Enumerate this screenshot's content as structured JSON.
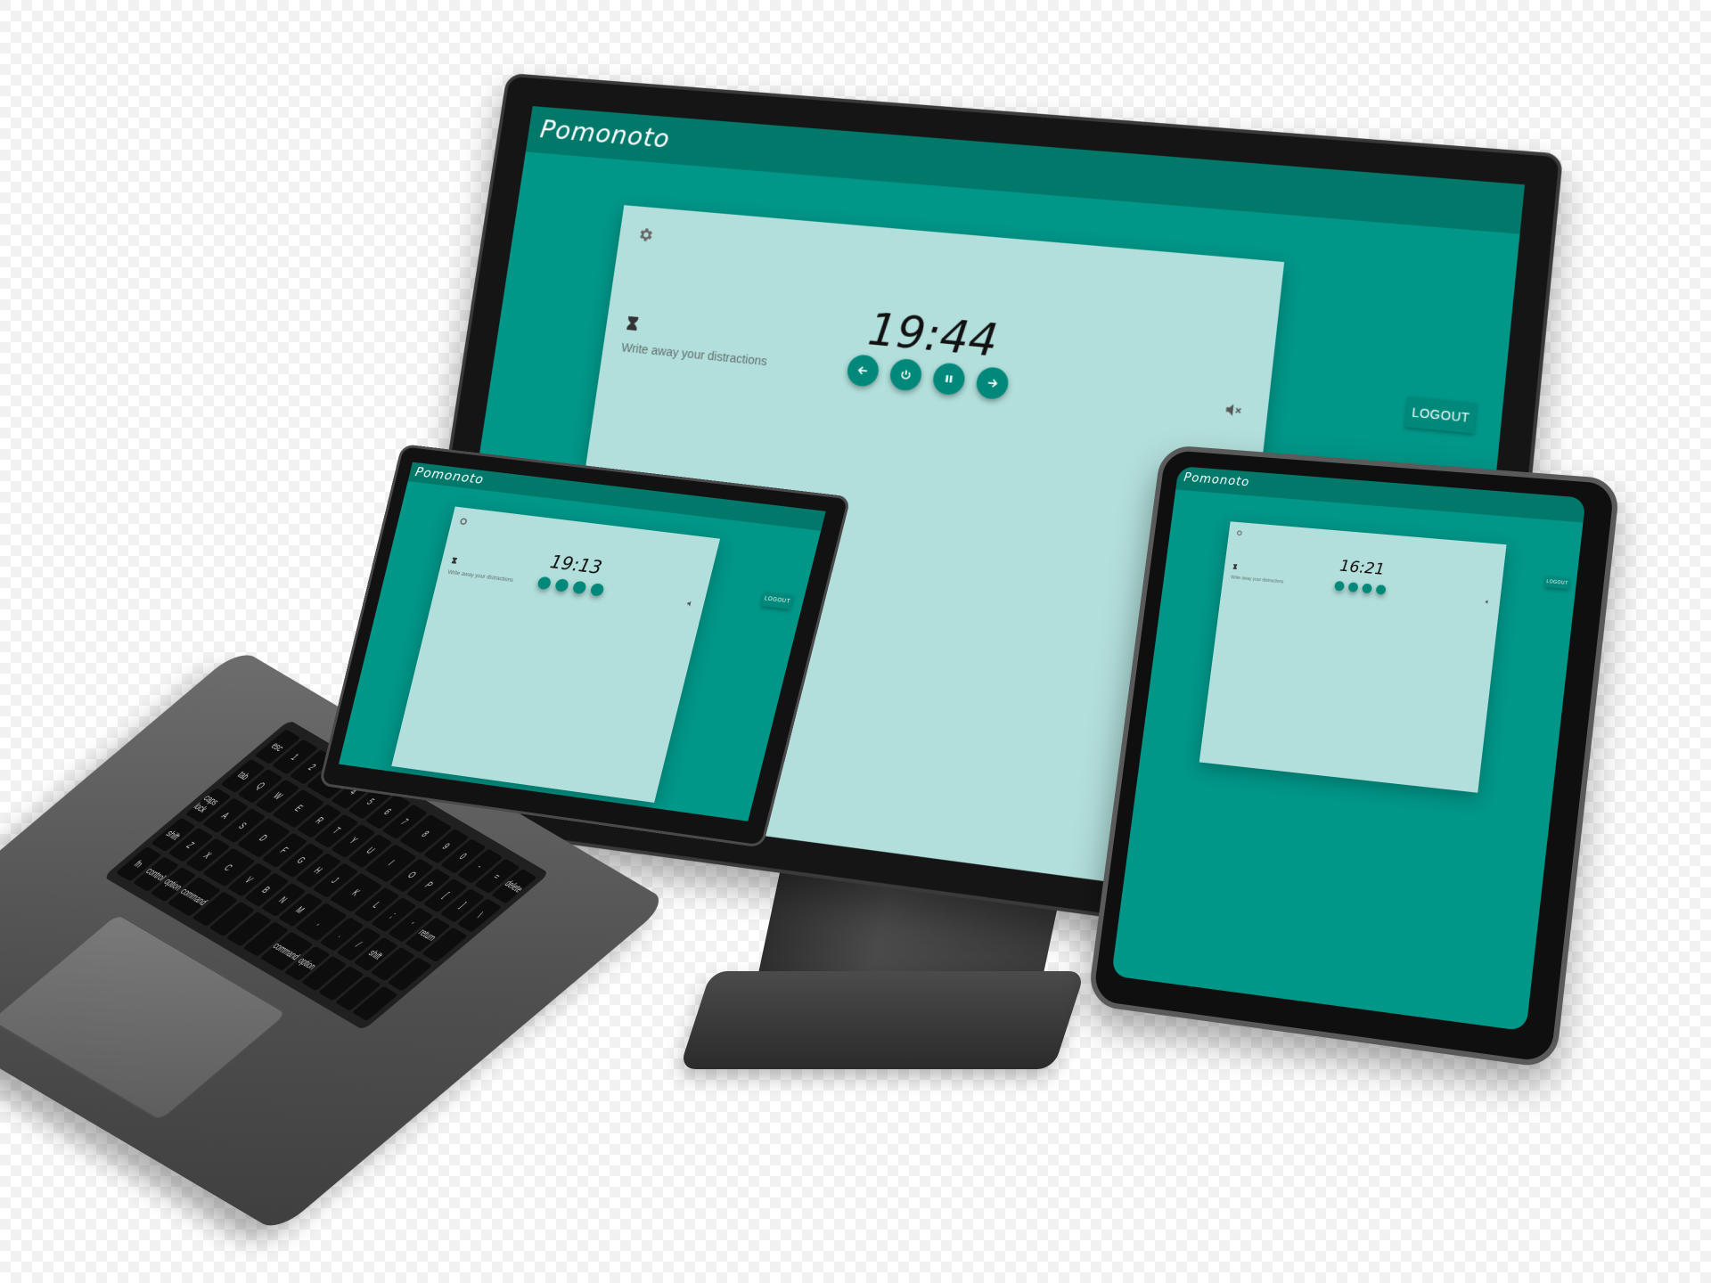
{
  "app": {
    "name": "Pomonoto",
    "logout_label": "LOGOUT",
    "placeholder": "Write away your distractions",
    "colors": {
      "primary": "#009688",
      "primary_dark": "#00796b",
      "surface": "#b2dfdb",
      "text": "#111111",
      "device_frame": "#151515",
      "device_shell": "#5a5a5a"
    },
    "icons": {
      "settings": "gear-icon",
      "hourglass": "hourglass-icon",
      "mute": "mute-icon",
      "back": "arrow-left-icon",
      "restart": "power-icon",
      "pause": "pause-icon",
      "forward": "arrow-right-icon"
    }
  },
  "devices": {
    "monitor": {
      "timer": "19:44"
    },
    "laptop": {
      "timer": "19:13"
    },
    "tablet": {
      "timer": "16:21"
    }
  },
  "keyboard": {
    "keys": [
      "esc",
      "1",
      "2",
      "3",
      "4",
      "5",
      "6",
      "7",
      "8",
      "9",
      "0",
      "-",
      "=",
      "delete",
      "tab",
      "Q",
      "W",
      "E",
      "R",
      "T",
      "Y",
      "U",
      "I",
      "O",
      "P",
      "[",
      "]",
      "\\",
      "caps lock",
      "A",
      "S",
      "D",
      "F",
      "G",
      "H",
      "J",
      "K",
      "L",
      ";",
      "'",
      "return",
      "",
      "shift",
      "Z",
      "X",
      "C",
      "V",
      "B",
      "N",
      "M",
      ",",
      ".",
      "/",
      "shift",
      "",
      "",
      "fn",
      "control",
      "option",
      "command",
      "",
      "",
      "",
      "",
      "command",
      "option",
      "",
      "",
      "",
      ""
    ]
  }
}
